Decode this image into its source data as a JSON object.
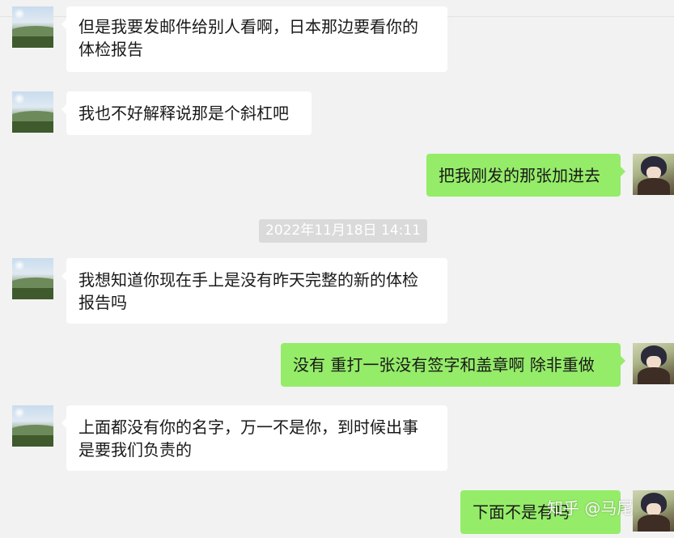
{
  "messages": [
    {
      "direction": "in",
      "lines": [
        "但是我要发邮件给别人看啊，日本那边要看你的",
        "体检报告"
      ]
    },
    {
      "direction": "in",
      "lines": [
        "我也不好解释说那是个斜杠吧"
      ]
    },
    {
      "direction": "out",
      "lines": [
        "把我刚发的那张加进去"
      ]
    },
    {
      "direction": "in",
      "lines": [
        "我想知道你现在手上是没有昨天完整的新的体检",
        "报告吗"
      ]
    },
    {
      "direction": "out",
      "lines": [
        "没有 重打一张没有签字和盖章啊 除非重做"
      ]
    },
    {
      "direction": "in",
      "lines": [
        "上面都没有你的名字，万一不是你，到时候出事",
        "是要我们负责的"
      ]
    },
    {
      "direction": "out",
      "lines": [
        "下面不是有吗"
      ]
    }
  ],
  "timestamp": "2022年11月18日 14:11",
  "watermark": "知乎 @马尾",
  "colors": {
    "background": "#f2f2f2",
    "incoming_bubble": "#ffffff",
    "outgoing_bubble": "#95ec69",
    "timestamp_bg": "#dadada"
  }
}
